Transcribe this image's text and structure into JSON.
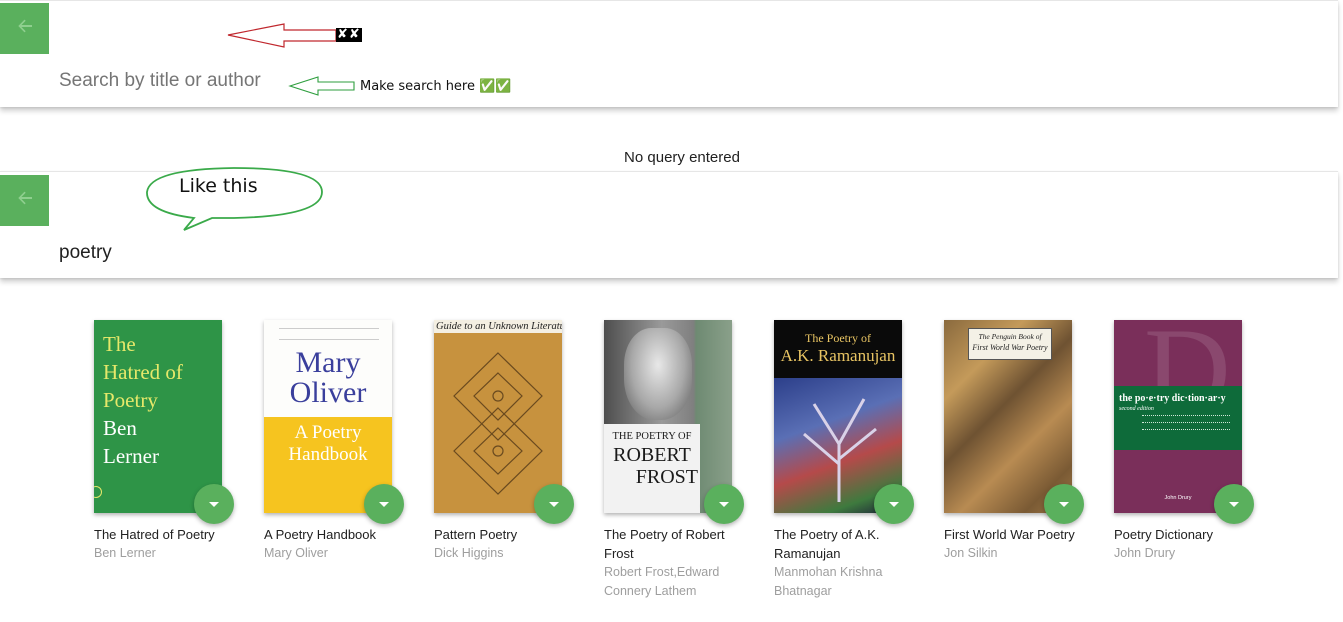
{
  "search_bar_1": {
    "placeholder": "Search by title or author",
    "annotation_marks": "✘✘",
    "annotation_note": "Make search here ✅✅"
  },
  "results_message": "No query entered",
  "callout": "Like this",
  "search_bar_2": {
    "query": "poetry"
  },
  "colors": {
    "accent": "#5ab05d",
    "red_annotation": "#c0272d",
    "green_annotation": "#2e9e3e"
  },
  "books": [
    {
      "title": "The Hatred of Poetry",
      "author": "Ben Lerner",
      "cover_text": [
        "The",
        "Hatred of",
        "Poetry",
        "Ben",
        "Lerner"
      ]
    },
    {
      "title": "A Poetry Handbook",
      "author": "Mary Oliver",
      "cover_text": [
        "Mary",
        "Oliver",
        "A Poetry",
        "Handbook"
      ]
    },
    {
      "title": "Pattern Poetry",
      "author": "Dick Higgins",
      "cover_text": [
        "Guide to an Unknown Literature"
      ]
    },
    {
      "title": "The Poetry of Robert Frost",
      "author": "Robert Frost,Edward Connery Lathem",
      "cover_text": [
        "THE POETRY OF",
        "ROBERT",
        "FROST"
      ]
    },
    {
      "title": "The Poetry of A.K. Ramanujan",
      "author": "Manmohan Krishna Bhatnagar",
      "cover_text": [
        "The Poetry of",
        "A.K. Ramanujan"
      ]
    },
    {
      "title": "First World War Poetry",
      "author": "Jon Silkin",
      "cover_text": [
        "The Penguin Book of",
        "First World War Poetry"
      ]
    },
    {
      "title": "Poetry Dictionary",
      "author": "John Drury",
      "cover_text": [
        "the po·e·try dic·tion·ar·y",
        "second edition",
        "John Drury"
      ]
    }
  ]
}
